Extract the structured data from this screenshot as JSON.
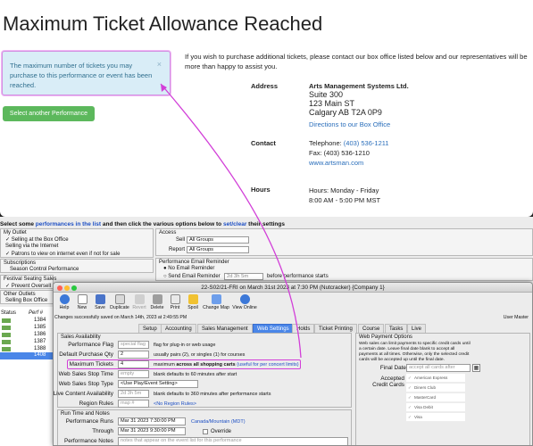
{
  "web": {
    "title": "Maximum Ticket Allowance Reached",
    "alert_text": "The maximum number of tickets you may purchase to this performance or event has been reached.",
    "close_glyph": "×",
    "select_button": "Select another Performance",
    "info_text": "If you wish to purchase additional tickets, please contact our box office listed below and our representatives will be more than happy to assist you.",
    "address_label": "Address",
    "address_name": "Arts Management Systems Ltd.",
    "address_line1": "Suite 300",
    "address_line2": "123 Main ST",
    "address_line3": "Calgary AB T2A 0P9",
    "directions_link": "Directions to our Box Office",
    "contact_label": "Contact",
    "telephone_prefix": "Telephone: ",
    "telephone": "(403) 536-1211",
    "fax": "Fax: (403) 536-1210",
    "website": "www.artsman.com",
    "hours_label": "Hours",
    "hours_days": "Hours: Monday - Friday",
    "hours_time": "8:00 AM - 5:00 PM MST"
  },
  "desk": {
    "head_pre": "Select some ",
    "head_link1": "performances in the list",
    "head_mid": " and then click the various options below to ",
    "head_link2": "set/clear",
    "head_post": " their settings",
    "my_outlet": "My Outlet",
    "selling_box_office": "✓ Selling at the Box Office",
    "selling_internet": "  Selling via the Internet",
    "patrons_view": "✓ Patrons to view on internet even if not for sale",
    "subscriptions": "Subscriptions",
    "season_control": "Season Control Performance",
    "festival": "Festival Seating Sales",
    "prevent_oversell": "✓ Prevent Oversell",
    "other_outlets": "Other Outlets",
    "selling_box_office2": "  Selling Box Office",
    "access": "Access",
    "sell_label": "Sell",
    "sell_value": "All Groups",
    "report_label": "Report",
    "report_value": "All Groups",
    "email_reminder_title": "Performance Email Reminder",
    "no_email_reminder": "No Email Reminder",
    "send_email_reminder": "Send Email Reminder",
    "reminder_value": "2d 3h 5m",
    "before_start": "before performance starts",
    "status_col": "Status",
    "perf_col": "Perf #",
    "list_rows": [
      "1384",
      "1385",
      "1386",
      "1387",
      "1388",
      "1408"
    ]
  },
  "dialog": {
    "title": "22-S02/21-FRI on March 31st 2023 at 7:30 PM (Nutcracker) {Company 1}",
    "toolbar": [
      "Help",
      "New",
      "Save",
      "Duplicate",
      "Revert",
      "Delete",
      "Print",
      "Spoil",
      "Change Map",
      "View Online"
    ],
    "saved_msg": "Changes successfully saved on March 14th, 2023 at 2:49:55 PM",
    "user": "User Master",
    "tabs": [
      "Setup",
      "Accounting",
      "Sales Management",
      "Web Settings",
      "Holds",
      "Ticket Printing",
      "Course",
      "Tasks",
      "Live"
    ],
    "sales_availability": "Sales Availability",
    "performance_flag_label": "Performance Flag",
    "performance_flag_value": "special flag",
    "performance_flag_note": "flag for plug-in or web usage",
    "default_qty_label": "Default Purchase Qty",
    "default_qty_value": "2",
    "default_qty_note": "usually pairs (2), or singles (1) for courses",
    "max_tickets_label": "Maximum Tickets",
    "max_tickets_value": "4",
    "max_note_pre": "maximum ",
    "max_note_bold": "across all shopping carts",
    "max_note_link": " (useful for per concert limits)",
    "stop_time_label": "Web Sales Stop Time",
    "stop_time_value": "empty",
    "stop_time_note": "blank defaults to 60 minutes after start",
    "stop_type_label": "Web Sales Stop Type",
    "stop_type_value": "<Use Play/Event Setting>",
    "live_content_label": "Live Content Availability",
    "live_content_value": "2d 3h 5m",
    "live_content_note": "blank defaults to 360 minutes after performance starts",
    "region_label": "Region Rules",
    "region_value": "map #",
    "region_link": "<No Region Rules>",
    "run_time": "Run Time and Notes",
    "runs_label": "Performance Runs",
    "runs_value": "Mar 31 2023 7:30:00 PM",
    "timezone": "Canada/Mountain (MDT)",
    "through_label": "Through",
    "through_value": "Mar 31 2023 9:30:00 PM",
    "override": "Override",
    "notes_label": "Performance Notes",
    "notes_placeholder": "notes that appear on the event list for this performance",
    "web_payment": "Web Payment Options",
    "web_payment_text1": "Web sales can limit payments to specific credit cards until",
    "web_payment_text2": "a certain date.  Leave final date blank to accept all",
    "web_payment_text3": "payments at all times.  Otherwise, only the selected credit",
    "web_payment_text4": "cards will be accepted up until the final date.",
    "final_date_label": "Final Date",
    "final_date_placeholder": "accept all cards after",
    "accepted_label": "Accepted Credit Cards",
    "cards": [
      "American Express",
      "Diners Club",
      "MasterCard",
      "Visa Debit",
      "Visa"
    ]
  },
  "colors": {
    "highlight": "#d23fd8",
    "alert_bg": "#d9edf7",
    "button_green": "#5cb85c",
    "tab_active": "#4a86e8"
  }
}
